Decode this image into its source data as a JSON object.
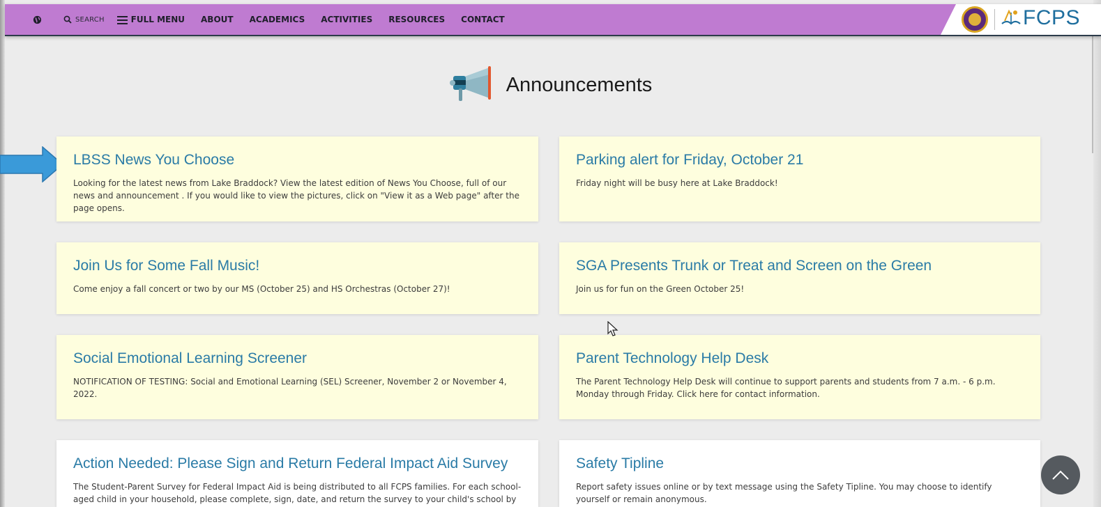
{
  "nav": {
    "search_label": "SEARCH",
    "full_menu_label": "FULL MENU",
    "items": [
      "ABOUT",
      "ACADEMICS",
      "ACTIVITIES",
      "RESOURCES",
      "CONTACT"
    ]
  },
  "logo": {
    "district_text": "FCPS"
  },
  "main": {
    "section_title": "Announcements"
  },
  "announcements": [
    {
      "title": "LBSS News You Choose",
      "text": "Looking for the latest news from Lake Braddock? View the latest edition of News You Choose, full of our news and announcement . If you would like to view the pictures, click on \"View it as a Web page\" after the page opens."
    },
    {
      "title": "Parking alert for Friday, October 21",
      "text": "Friday night will be busy here at Lake Braddock!"
    },
    {
      "title": "Join Us for Some Fall Music!",
      "text": "Come enjoy a fall concert or two by our MS (October 25) and HS Orchestras (October 27)!"
    },
    {
      "title": "SGA Presents Trunk or Treat and Screen on the Green",
      "text": "Join us for fun on the Green October 25!"
    },
    {
      "title": "Social Emotional Learning Screener",
      "text": "NOTIFICATION OF TESTING: Social and Emotional Learning (SEL) Screener, November 2 or November 4, 2022."
    },
    {
      "title": "Parent Technology Help Desk",
      "text": "The Parent Technology Help Desk will continue to support parents and students from 7 a.m. - 6 p.m. Monday through Friday. Click here for contact information."
    },
    {
      "title": "Action Needed: Please Sign and Return Federal Impact Aid Survey",
      "text": "The Student-Parent Survey for Federal Impact Aid is being distributed to all FCPS families. For each school-aged child in your household, please complete, sign, date, and return the survey to your child's school by November"
    },
    {
      "title": "Safety Tipline",
      "text": "Report safety issues online or by text message using the Safety Tipline.  You may choose to identify yourself or remain anonymous."
    }
  ],
  "colors": {
    "topbar": "#bf7bd1",
    "card_background": "#fefede",
    "title_link": "#2a7ba6",
    "pointer_arrow": "#3a9ad9"
  }
}
